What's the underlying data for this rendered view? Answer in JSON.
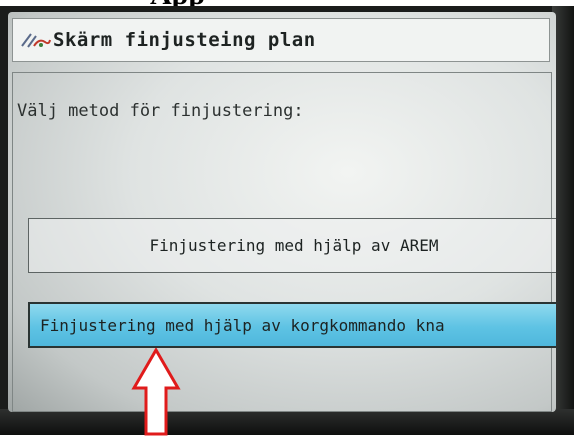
{
  "caption": {
    "text": "App"
  },
  "window": {
    "title": "Skärm finjusteing plan",
    "icon": "calibration-tool-icon"
  },
  "main": {
    "prompt": "Välj metod för finjustering:",
    "options": [
      {
        "label": "Finjustering med hjälp av AREM",
        "selected": false
      },
      {
        "label": "Finjustering med hjälp av korgkommando kna",
        "selected": true
      }
    ]
  },
  "annotation": {
    "icon": "arrow-up-icon",
    "color": "#e01b1b"
  },
  "colors": {
    "selected_fill": "#5ec3e4",
    "screen_bg": "#dfe3e2",
    "bezel": "#1a1c1b"
  }
}
